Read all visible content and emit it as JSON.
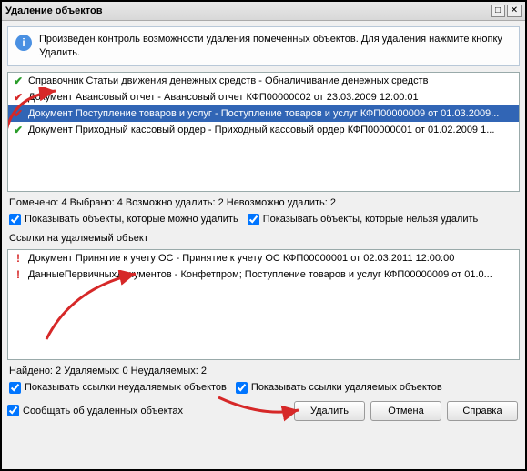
{
  "titlebar": {
    "title": "Удаление объектов"
  },
  "info": {
    "text": "Произведен контроль возможности удаления помеченных объектов. Для удаления нажмите кнопку Удалить."
  },
  "main_list": {
    "rows": [
      {
        "status": "ok",
        "text": "Справочник Статьи движения денежных средств - Обналичивание денежных средств"
      },
      {
        "status": "bad",
        "text": "Документ Авансовый отчет - Авансовый отчет КФП00000002 от 23.03.2009 12:00:01"
      },
      {
        "status": "bad",
        "text": "Документ Поступление товаров и услуг - Поступление товаров и услуг КФП00000009 от 01.03.2009...",
        "selected": true
      },
      {
        "status": "ok",
        "text": "Документ Приходный кассовый ордер - Приходный кассовый ордер КФП00000001 от 01.02.2009 1..."
      }
    ]
  },
  "status1": "Помечено: 4  Выбрано: 4  Возможно удалить: 2  Невозможно удалить: 2",
  "checks1": {
    "show_deletable": "Показывать объекты, которые можно удалить",
    "show_undeletable": "Показывать объекты, которые нельзя удалить"
  },
  "section_refs": "Ссылки на удаляемый объект",
  "refs_list": {
    "rows": [
      {
        "status": "excl",
        "text": "Документ Принятие к учету ОС - Принятие к учету ОС КФП00000001 от 02.03.2011 12:00:00"
      },
      {
        "status": "excl",
        "text": "ДанныеПервичныхДокументов  - Конфетпром; Поступление товаров и услуг КФП00000009 от 01.0..."
      }
    ]
  },
  "status2": "Найдено: 2  Удаляемых: 0  Неудаляемых: 2",
  "checks2": {
    "show_undeletable_refs": "Показывать ссылки неудаляемых объектов",
    "show_deletable_refs": "Показывать ссылки удаляемых объектов"
  },
  "checks3": {
    "report_deleted": "Сообщать об удаленных объектах"
  },
  "buttons": {
    "delete": "Удалить",
    "cancel": "Отмена",
    "help": "Справка"
  }
}
